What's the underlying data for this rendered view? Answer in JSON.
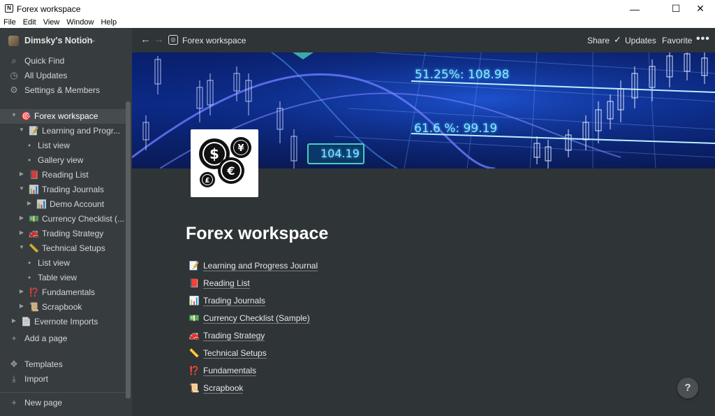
{
  "window": {
    "title": "Forex workspace",
    "controls": {
      "minimize": "—",
      "maximize": "☐",
      "close": "✕"
    }
  },
  "menu": [
    "File",
    "Edit",
    "View",
    "Window",
    "Help"
  ],
  "sidebar": {
    "workspace_name": "Dimsky's Notion",
    "top_items": [
      {
        "label": "Quick Find",
        "icon": "search-icon"
      },
      {
        "label": "All Updates",
        "icon": "clock-icon"
      },
      {
        "label": "Settings & Members",
        "icon": "gear-icon"
      }
    ],
    "tree": [
      {
        "label": "Forex workspace",
        "icon": "🎯"
      },
      {
        "label": "Learning and Progr...",
        "icon": "📝"
      },
      {
        "label": "List view"
      },
      {
        "label": "Gallery view"
      },
      {
        "label": "Reading List",
        "icon": "📕"
      },
      {
        "label": "Trading Journals",
        "icon": "📊"
      },
      {
        "label": "Demo Account",
        "icon": "📊"
      },
      {
        "label": "Currency Checklist (...",
        "icon": "💵"
      },
      {
        "label": "Trading Strategy",
        "icon": "🚒"
      },
      {
        "label": "Technical Setups",
        "icon": "📏"
      },
      {
        "label": "List view"
      },
      {
        "label": "Table view"
      },
      {
        "label": "Fundamentals",
        "icon": "⁉️"
      },
      {
        "label": "Scrapbook",
        "icon": "📜"
      },
      {
        "label": "Evernote Imports",
        "icon": "📄"
      }
    ],
    "add_page": "Add a page",
    "templates": "Templates",
    "import": "Import",
    "new_page": "New page"
  },
  "topbar": {
    "breadcrumb": "Forex workspace",
    "share": "Share",
    "updates": "Updates",
    "favorite": "Favorite",
    "more": "•••"
  },
  "cover": {
    "labels": [
      "51.25%: 108.98",
      "61.6 %: 99.19",
      "104.19"
    ]
  },
  "page": {
    "title": "Forex workspace",
    "links": [
      {
        "icon": "📝",
        "label": "Learning and Progress Journal"
      },
      {
        "icon": "📕",
        "label": "Reading List"
      },
      {
        "icon": "📊",
        "label": "Trading Journals"
      },
      {
        "icon": "💵",
        "label": "Currency Checklist (Sample)"
      },
      {
        "icon": "🚒",
        "label": "Trading Strategy"
      },
      {
        "icon": "📏",
        "label": "Technical Setups"
      },
      {
        "icon": "⁉️",
        "label": "Fundamentals"
      },
      {
        "icon": "📜",
        "label": "Scrapbook"
      }
    ]
  },
  "help": "?",
  "icon_glyphs": {
    "search": "⌕",
    "clock": "◷",
    "gear": "⚙",
    "plus": "+",
    "templates": "❖",
    "import": "⤓",
    "arrow_down": "▼",
    "arrow_right": "▶",
    "chevron": "⌃⌄",
    "back": "←",
    "forward": "→",
    "check": "✓",
    "dot": "•"
  },
  "colors": {
    "sidebar_bg": "#373c3f",
    "main_bg": "#2f3437",
    "active_row": "#464b4e",
    "cover_blue": "#0b2a8a",
    "chart_cyan": "#8fe6ff"
  }
}
